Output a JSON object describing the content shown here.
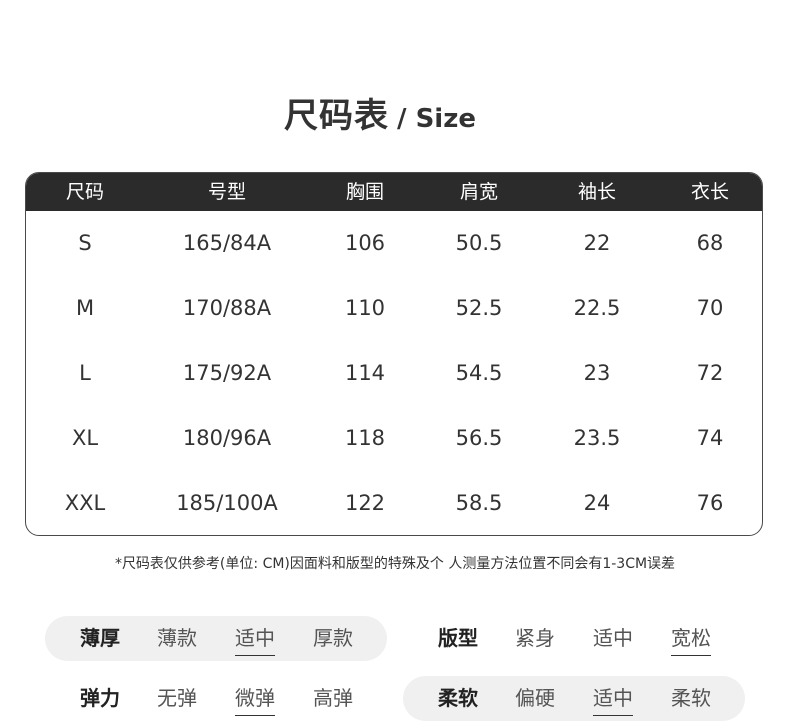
{
  "title": {
    "zh": "尺码表",
    "en": "/ Size"
  },
  "table": {
    "headers": [
      "尺码",
      "号型",
      "胸围",
      "肩宽",
      "袖长",
      "衣长"
    ],
    "rows": [
      [
        "S",
        "165/84A",
        "106",
        "50.5",
        "22",
        "68"
      ],
      [
        "M",
        "170/88A",
        "110",
        "52.5",
        "22.5",
        "70"
      ],
      [
        "L",
        "175/92A",
        "114",
        "54.5",
        "23",
        "72"
      ],
      [
        "XL",
        "180/96A",
        "118",
        "56.5",
        "23.5",
        "74"
      ],
      [
        "XXL",
        "185/100A",
        "122",
        "58.5",
        "24",
        "76"
      ]
    ]
  },
  "note": "*尺码表仅供参考(单位: CM)因面料和版型的特殊及个 人测量方法位置不同会有1-3CM误差",
  "attributes": {
    "thickness": {
      "label": "薄厚",
      "options": [
        "薄款",
        "适中",
        "厚款"
      ],
      "selected": "适中"
    },
    "fit": {
      "label": "版型",
      "options": [
        "紧身",
        "适中",
        "宽松"
      ],
      "selected": "宽松"
    },
    "stretch": {
      "label": "弹力",
      "options": [
        "无弹",
        "微弹",
        "高弹"
      ],
      "selected": "微弹"
    },
    "softness": {
      "label": "柔软",
      "options": [
        "偏硬",
        "适中",
        "柔软"
      ],
      "selected": "适中"
    }
  }
}
